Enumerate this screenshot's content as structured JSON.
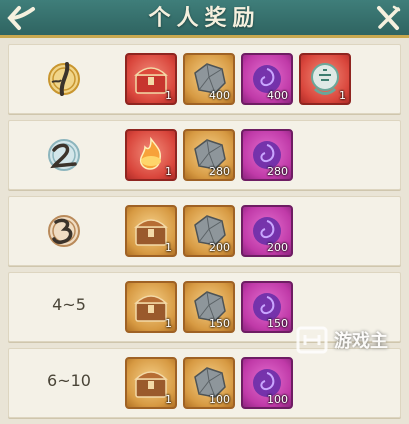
{
  "header": {
    "title": "个人奖励"
  },
  "rows": [
    {
      "rank_label": "",
      "items": [
        {
          "type": "chest",
          "rarity": "red",
          "icon": "red-chest-icon",
          "qty": "1"
        },
        {
          "type": "ore",
          "rarity": "gold",
          "icon": "silver-ore-icon",
          "qty": "400"
        },
        {
          "type": "orb",
          "rarity": "purple",
          "icon": "spirit-orb-icon",
          "qty": "400"
        },
        {
          "type": "charm",
          "rarity": "red",
          "icon": "ornament-icon",
          "qty": "1"
        }
      ]
    },
    {
      "rank_label": "",
      "items": [
        {
          "type": "flame",
          "rarity": "red",
          "icon": "flame-item-icon",
          "qty": "1"
        },
        {
          "type": "ore",
          "rarity": "gold",
          "icon": "silver-ore-icon",
          "qty": "280"
        },
        {
          "type": "orb",
          "rarity": "purple",
          "icon": "spirit-orb-icon",
          "qty": "280"
        }
      ]
    },
    {
      "rank_label": "",
      "items": [
        {
          "type": "chest",
          "rarity": "gold",
          "icon": "wooden-chest-icon",
          "qty": "1"
        },
        {
          "type": "ore",
          "rarity": "gold",
          "icon": "silver-ore-icon",
          "qty": "200"
        },
        {
          "type": "orb",
          "rarity": "purple",
          "icon": "spirit-orb-icon",
          "qty": "200"
        }
      ]
    },
    {
      "rank_label": "4~5",
      "items": [
        {
          "type": "chest",
          "rarity": "gold",
          "icon": "wooden-chest-icon",
          "qty": "1"
        },
        {
          "type": "ore",
          "rarity": "gold",
          "icon": "silver-ore-icon",
          "qty": "150"
        },
        {
          "type": "orb",
          "rarity": "purple",
          "icon": "spirit-orb-icon",
          "qty": "150"
        }
      ]
    },
    {
      "rank_label": "6~10",
      "items": [
        {
          "type": "chest",
          "rarity": "gold",
          "icon": "wooden-chest-icon",
          "qty": "1"
        },
        {
          "type": "ore",
          "rarity": "gold",
          "icon": "silver-ore-icon",
          "qty": "100"
        },
        {
          "type": "orb",
          "rarity": "purple",
          "icon": "spirit-orb-icon",
          "qty": "100"
        }
      ]
    }
  ],
  "watermark": {
    "text": "游戏主"
  },
  "colors": {
    "header": "#3f7e7a",
    "accent": "#c9a84f",
    "row_bg": "#f4f1e7"
  }
}
